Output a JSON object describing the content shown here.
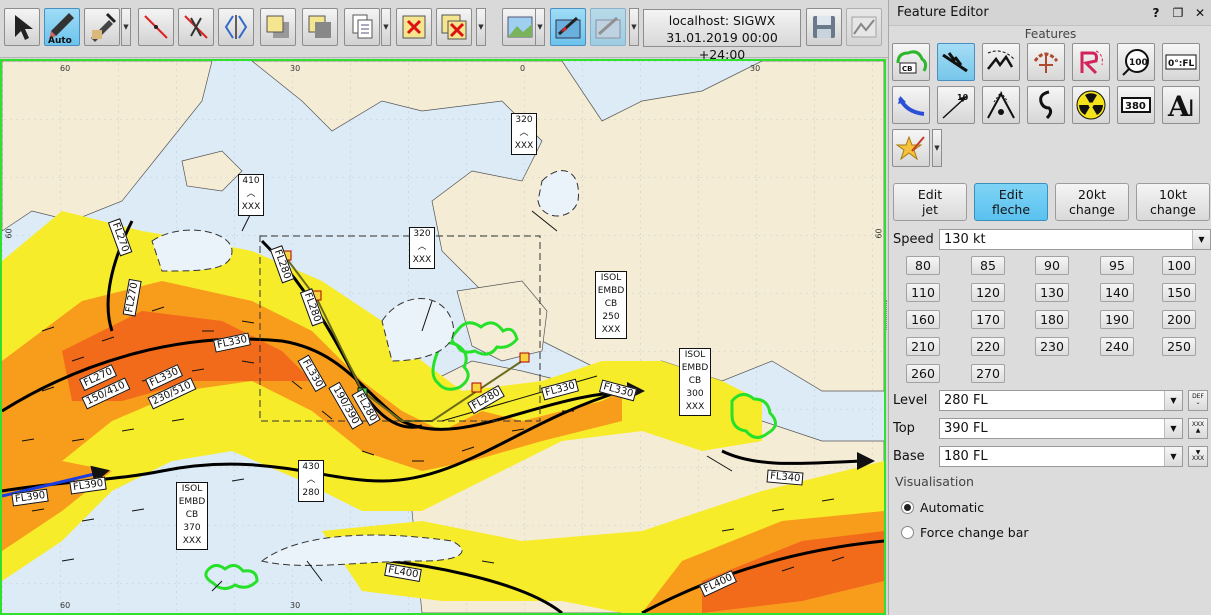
{
  "toolbar": {
    "server_line1": "localhost: SIGWX",
    "server_line2": "31.01.2019 00:00 +24:00",
    "auto_label": "Auto",
    "buttons": [
      "select-tool",
      "auto-tool",
      "edit-tool",
      "line-tool",
      "cut-tool",
      "split-tool",
      "raise-tool",
      "lower-tool",
      "copy-tool",
      "delete-tool",
      "delete-multi-tool",
      "background-tool",
      "symbol-tool",
      "grid-tool",
      "save-tool",
      "chart-tool"
    ]
  },
  "map": {
    "coords_top": [
      "60",
      "30",
      "0",
      "30"
    ],
    "coords_bottom": [
      "60",
      "30"
    ],
    "coords_left": [
      "60",
      "60"
    ],
    "labels": {
      "box410": [
        "410",
        "XXX"
      ],
      "box320a": [
        "320",
        "XXX"
      ],
      "box320b": [
        "320",
        "XXX"
      ],
      "box430": [
        "430",
        "280"
      ],
      "cb1": [
        "ISOL",
        "EMBD",
        "CB",
        "250",
        "XXX"
      ],
      "cb2": [
        "ISOL",
        "EMBD",
        "CB",
        "300",
        "XXX"
      ],
      "cb3": [
        "ISOL",
        "EMBD",
        "CB",
        "370",
        "XXX"
      ]
    },
    "jet_labels": [
      "FL270",
      "FL270",
      "FL280",
      "FL280",
      "FL330",
      "FL270",
      "150/410",
      "FL330",
      "230/510",
      "FL330",
      "190/390",
      "FL280",
      "FL280",
      "FL330",
      "FL330",
      "FL390",
      "FL390",
      "FL340",
      "FL400",
      "FL400"
    ]
  },
  "panel": {
    "title": "Feature Editor",
    "title_buttons": [
      "?",
      "❐",
      "✕"
    ],
    "features_label": "Features",
    "features": [
      "cb-cloud",
      "jet-stream",
      "turbulence",
      "icing",
      "volcano",
      "tropopause",
      "freezing-level",
      "front",
      "jet-arrow",
      "mountain-wave",
      "tropical-cyclone",
      "radiation",
      "flight-level-box",
      "text-annotation",
      "star-symbol"
    ],
    "feature_texts": {
      "cb": "CB",
      "zero": "0°:FL",
      "ten": "10",
      "hundred": "100",
      "level": "380",
      "text": "A",
      "text_cursor": "I"
    },
    "tabs": [
      {
        "line1": "Edit",
        "line2": "jet"
      },
      {
        "line1": "Edit",
        "line2": "fleche"
      },
      {
        "line1": "20kt",
        "line2": "change"
      },
      {
        "line1": "10kt",
        "line2": "change"
      }
    ],
    "speed_label": "Speed",
    "speed_value": "130 kt",
    "speeds": [
      "80",
      "85",
      "90",
      "95",
      "100",
      "110",
      "120",
      "130",
      "140",
      "150",
      "160",
      "170",
      "180",
      "190",
      "200",
      "210",
      "220",
      "230",
      "240",
      "250",
      "260",
      "270"
    ],
    "level_label": "Level",
    "level_value": "280 FL",
    "top_label": "Top",
    "top_value": "390 FL",
    "base_label": "Base",
    "base_value": "180 FL",
    "def_label": "DEF",
    "xxx_label": "XXX",
    "visualisation_label": "Visualisation",
    "radio_automatic": "Automatic",
    "radio_force": "Force change bar"
  }
}
